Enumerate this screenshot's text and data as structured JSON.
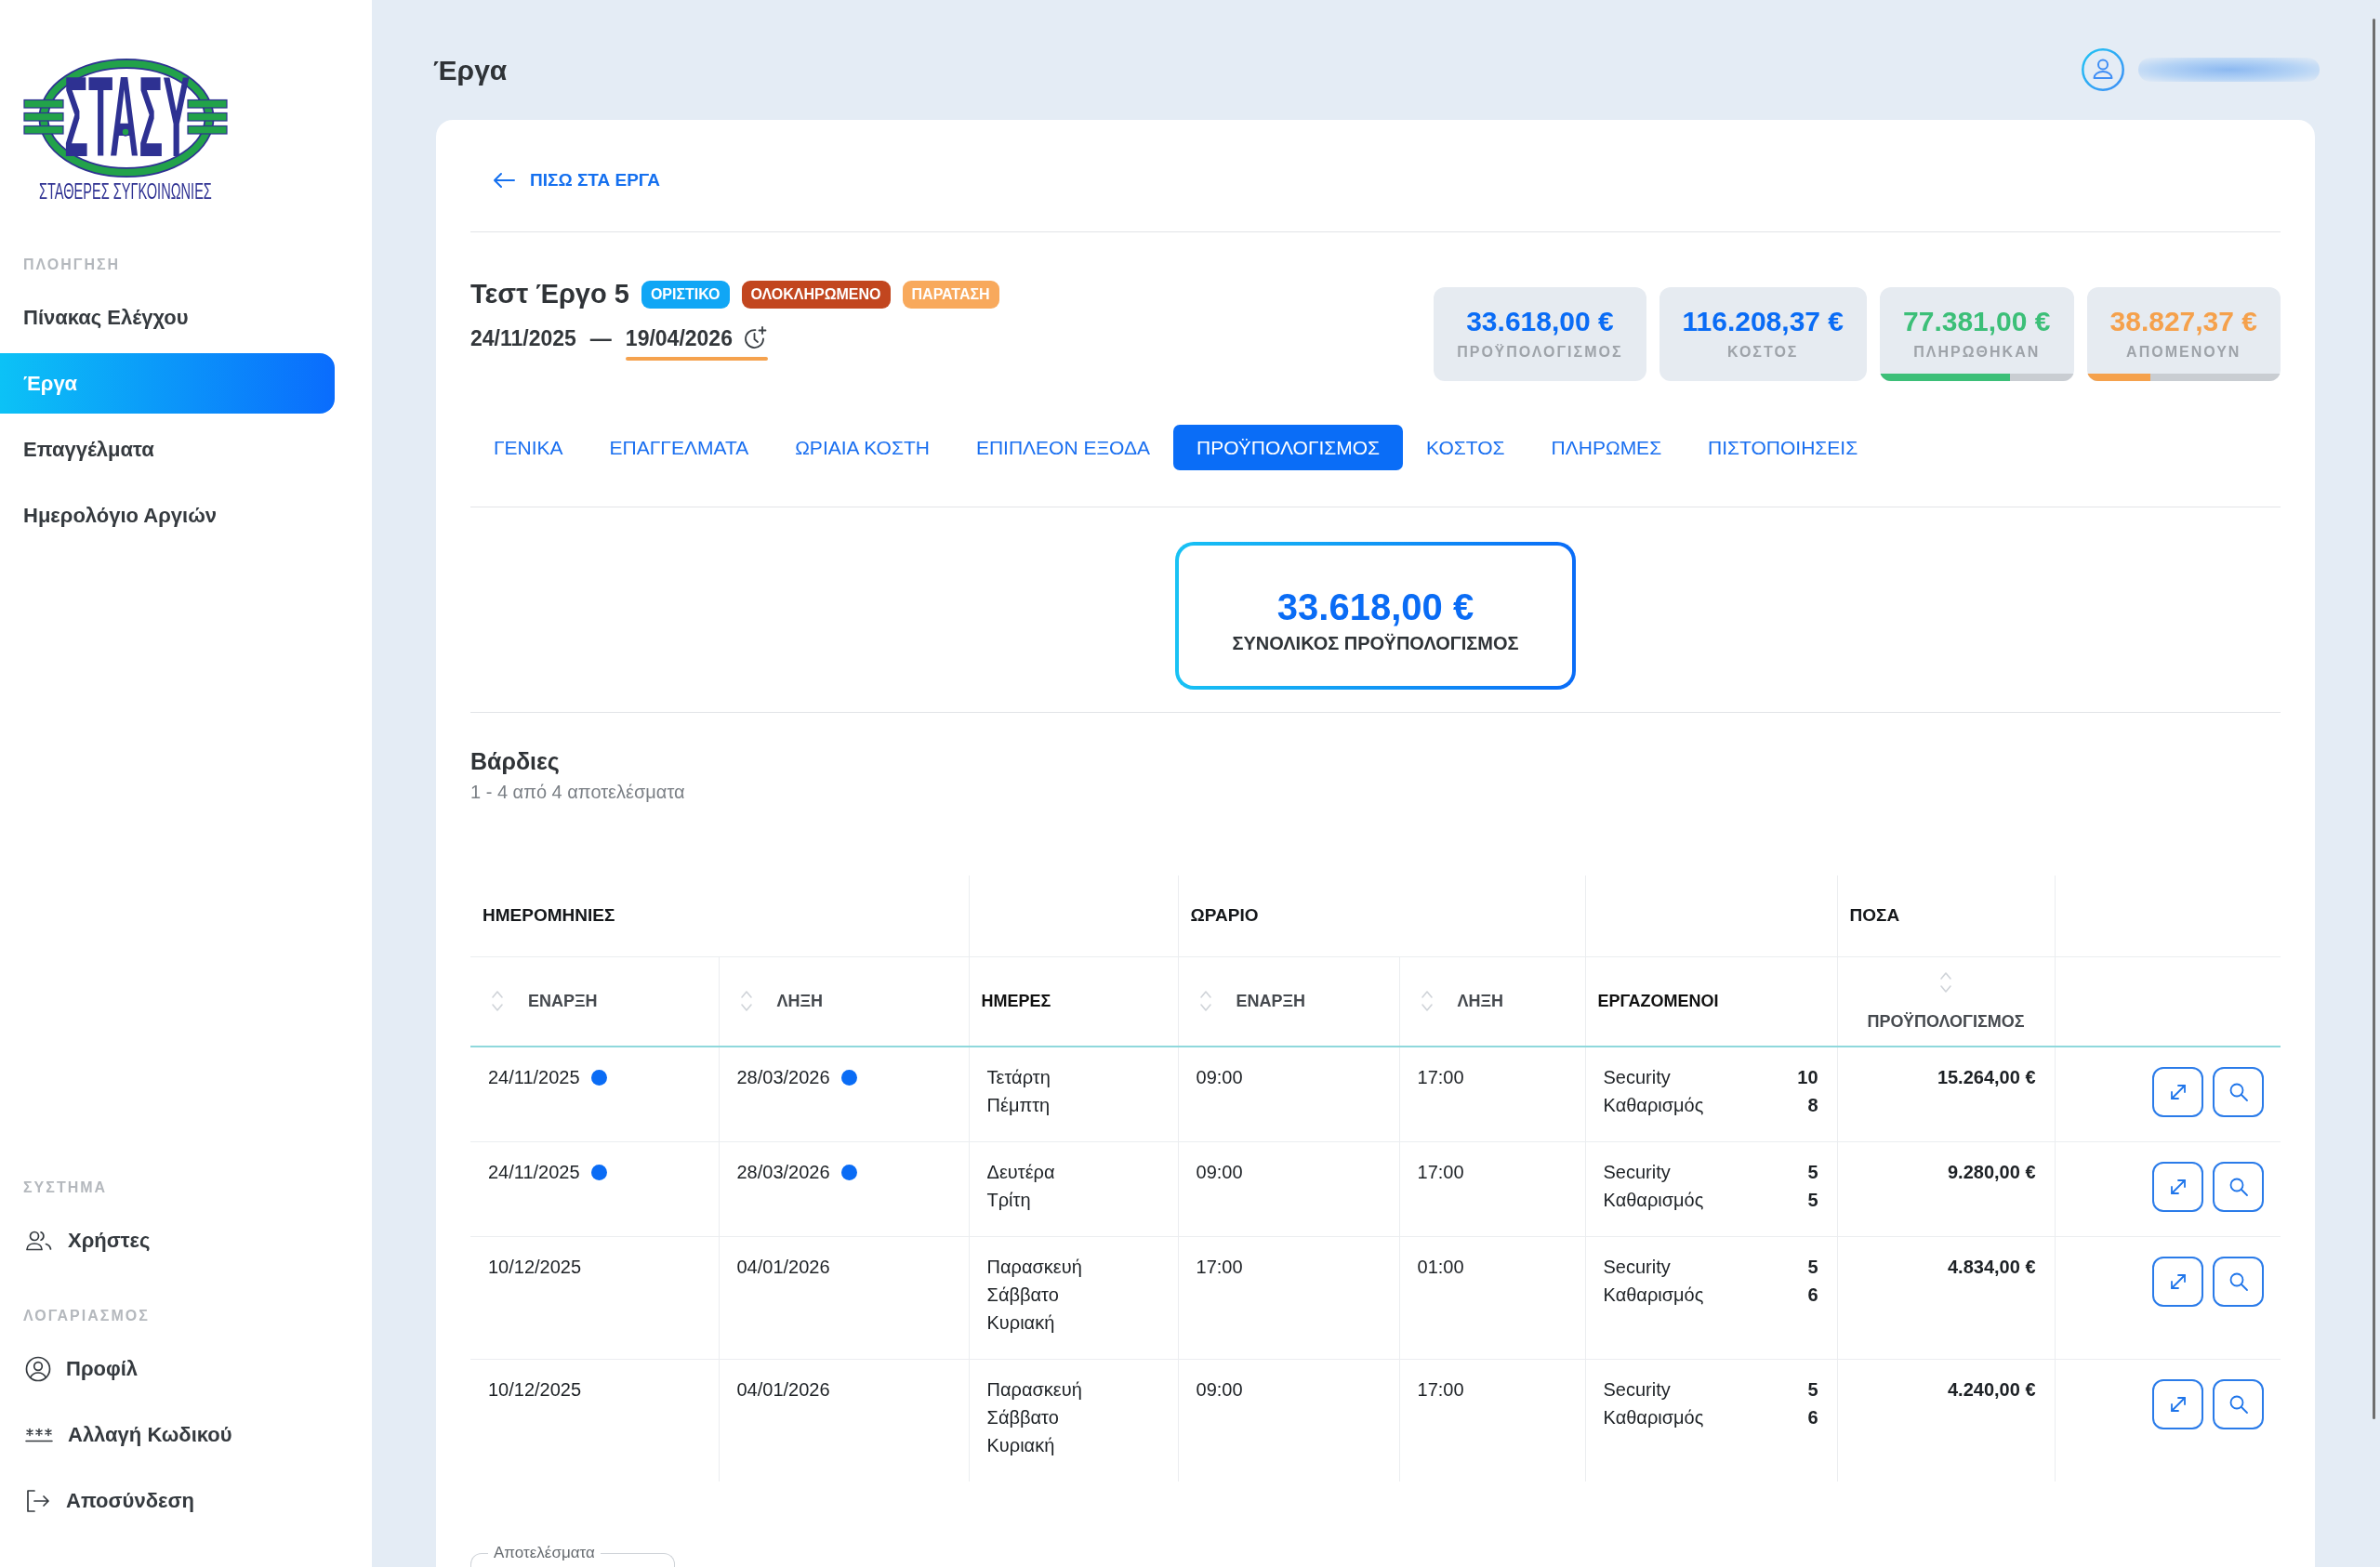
{
  "sidebar": {
    "logo": {
      "wordmark": "ΣΤΑΣΥ",
      "caption": "ΣΤΑΘΕΡΕΣ ΣΥΓΚΟΙΝΩΝΙΕΣ"
    },
    "sections_top": [
      {
        "heading": "ΠΛΟΗΓΗΣΗ",
        "items": [
          {
            "label": "Πίνακας Ελέγχου",
            "selected": false
          },
          {
            "label": "Έργα",
            "selected": true
          },
          {
            "label": "Επαγγέλματα",
            "selected": false
          },
          {
            "label": "Ημερολόγιο Αργιών",
            "selected": false
          }
        ]
      }
    ],
    "sections_bottom": [
      {
        "heading": "ΣΥΣΤΗΜΑ",
        "items": [
          {
            "label": "Χρήστες",
            "selected": false
          }
        ]
      },
      {
        "heading": "ΛΟΓΑΡΙΑΣΜΟΣ",
        "items": [
          {
            "label": "Προφίλ",
            "selected": false
          },
          {
            "label": "Αλλαγή Κωδικού",
            "selected": false
          },
          {
            "label": "Αποσύνδεση",
            "selected": false
          }
        ]
      }
    ]
  },
  "header": {
    "title": "Έργα"
  },
  "project": {
    "back_link": "ΠΙΣΩ ΣΤΑ ΕΡΓΑ",
    "title": "Τεστ Έργο 5",
    "badges": [
      {
        "label": "ΟΡΙΣΤΙΚΟ",
        "color": "#10a6f5"
      },
      {
        "label": "ΟΛΟΚΛΗΡΩΜΕΝΟ",
        "color": "#c2461f"
      },
      {
        "label": "ΠΑΡΑΤΑΣΗ",
        "color": "#f8a95c"
      }
    ],
    "start_date": "24/11/2025",
    "date_separator": "—",
    "end_date": "19/04/2026",
    "end_date_extended": true,
    "stats": [
      {
        "value": "33.618,00 €",
        "label": "ΠΡΟΫΠΟΛΟΓΙΣΜΟΣ",
        "color": "#0a6cf5"
      },
      {
        "value": "116.208,37 €",
        "label": "ΚΟΣΤΟΣ",
        "color": "#0a6cf5"
      },
      {
        "value": "77.381,00 €",
        "label": "ΠΛΗΡΩΘΗΚΑΝ",
        "color": "#3cbf78",
        "level": 0.67
      },
      {
        "value": "38.827,37 €",
        "label": "ΑΠΟΜΕΝΟΥΝ",
        "color": "#f5a14c",
        "level": 0.33
      }
    ]
  },
  "tabs": [
    {
      "label": "ΓΕΝΙΚΑ",
      "selected": false
    },
    {
      "label": "ΕΠΑΓΓΕΛΜΑΤΑ",
      "selected": false
    },
    {
      "label": "ΩΡΙΑΙΑ ΚΟΣΤΗ",
      "selected": false
    },
    {
      "label": "ΕΠΙΠΛΕΟΝ ΕΞΟΔΑ",
      "selected": false
    },
    {
      "label": "ΠΡΟΫΠΟΛΟΓΙΣΜΟΣ",
      "selected": true
    },
    {
      "label": "ΚΟΣΤΟΣ",
      "selected": false
    },
    {
      "label": "ΠΛΗΡΩΜΕΣ",
      "selected": false
    },
    {
      "label": "ΠΙΣΤΟΠΟΙΗΣΕΙΣ",
      "selected": false
    }
  ],
  "budget_total": {
    "value": "33.618,00 €",
    "label": "ΣΥΝΟΛΙΚΟΣ ΠΡΟΫΠΟΛΟΓΙΣΜΟΣ"
  },
  "shifts": {
    "title": "Βάρδιες",
    "summary": "1 - 4 από 4 αποτελέσματα",
    "column_groups": [
      {
        "label": "ΗΜΕΡΟΜΗΝΙΕΣ",
        "columns": [
          {
            "label": "ΕΝΑΡΞΗ",
            "kind": "date",
            "sortable": true
          },
          {
            "label": "ΛΗΞΗ",
            "kind": "date",
            "sortable": true
          }
        ]
      },
      {
        "columns": [
          {
            "label": "ΗΜΕΡΕΣ",
            "kind": "days",
            "sortable": false
          }
        ]
      },
      {
        "label": "ΩΡΑΡΙΟ",
        "columns": [
          {
            "label": "ΕΝΑΡΞΗ",
            "kind": "time",
            "sortable": true
          },
          {
            "label": "ΛΗΞΗ",
            "kind": "time",
            "sortable": true
          }
        ]
      },
      {
        "columns": [
          {
            "label": "ΕΡΓΑΖΟΜΕΝΟΙ",
            "kind": "staff",
            "sortable": false
          }
        ]
      },
      {
        "label": "ΠΟΣΑ",
        "columns": [
          {
            "label": "ΠΡΟΫΠΟΛΟΓΙΣΜΟΣ",
            "kind": "money",
            "sortable": true
          }
        ]
      },
      {
        "columns": [
          {
            "kind": "actions"
          }
        ]
      }
    ],
    "rows": [
      {
        "cells": [
          {
            "text": "24/11/2025",
            "dot": true
          },
          {
            "text": "28/03/2026",
            "dot": true
          },
          {
            "lines": [
              "Τετάρτη",
              "Πέμπτη"
            ]
          },
          {
            "text": "09:00"
          },
          {
            "text": "17:00"
          },
          {
            "staff": [
              {
                "role": "Security",
                "count": "10"
              },
              {
                "role": "Καθαρισμός",
                "count": "8"
              }
            ]
          },
          {
            "text": "15.264,00 €"
          }
        ]
      },
      {
        "cells": [
          {
            "text": "24/11/2025",
            "dot": true
          },
          {
            "text": "28/03/2026",
            "dot": true
          },
          {
            "lines": [
              "Δευτέρα",
              "Τρίτη"
            ]
          },
          {
            "text": "09:00"
          },
          {
            "text": "17:00"
          },
          {
            "staff": [
              {
                "role": "Security",
                "count": "5"
              },
              {
                "role": "Καθαρισμός",
                "count": "5"
              }
            ]
          },
          {
            "text": "9.280,00 €"
          }
        ]
      },
      {
        "cells": [
          {
            "text": "10/12/2025",
            "dot": false
          },
          {
            "text": "04/01/2026",
            "dot": false
          },
          {
            "lines": [
              "Παρασκευή",
              "Σάββατο",
              "Κυριακή"
            ]
          },
          {
            "text": "17:00"
          },
          {
            "text": "01:00"
          },
          {
            "staff": [
              {
                "role": "Security",
                "count": "5"
              },
              {
                "role": "Καθαρισμός",
                "count": "6"
              }
            ]
          },
          {
            "text": "4.834,00 €"
          }
        ]
      },
      {
        "cells": [
          {
            "text": "10/12/2025",
            "dot": false
          },
          {
            "text": "04/01/2026",
            "dot": false
          },
          {
            "lines": [
              "Παρασκευή",
              "Σάββατο",
              "Κυριακή"
            ]
          },
          {
            "text": "09:00"
          },
          {
            "text": "17:00"
          },
          {
            "staff": [
              {
                "role": "Security",
                "count": "5"
              },
              {
                "role": "Καθαρισμός",
                "count": "6"
              }
            ]
          },
          {
            "text": "4.240,00 €"
          }
        ]
      }
    ]
  },
  "page_size_field": {
    "label": "Αποτελέσματα"
  }
}
